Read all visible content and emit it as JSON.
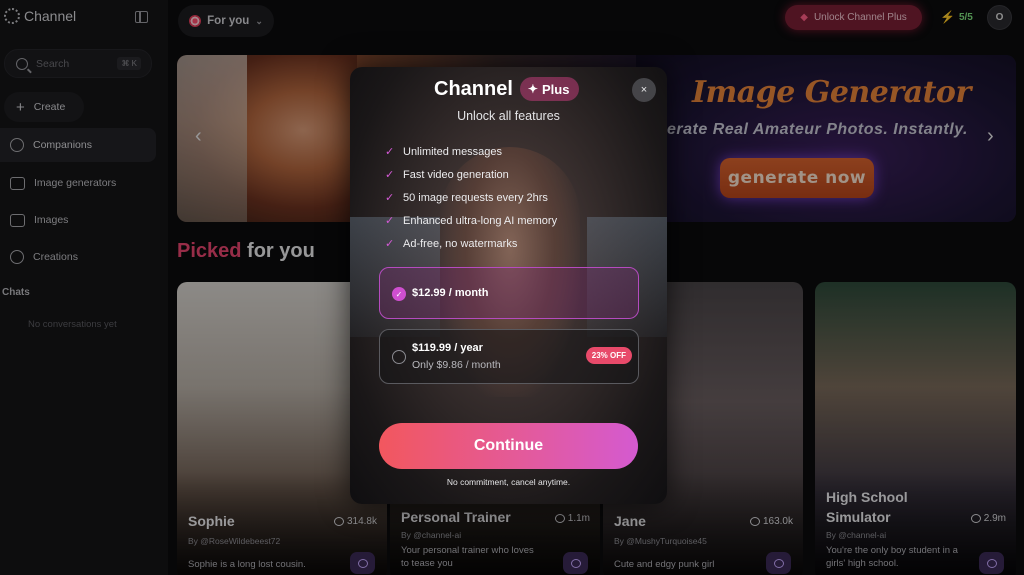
{
  "sidebar": {
    "brand": "Channel",
    "search_placeholder": "Search",
    "search_shortcut": "⌘ K",
    "create_label": "Create",
    "items": [
      {
        "label": "Companions"
      },
      {
        "label": "Image generators"
      },
      {
        "label": "Images"
      },
      {
        "label": "Creations"
      }
    ],
    "chats_heading": "Chats",
    "empty_chats": "No conversations yet"
  },
  "topbar": {
    "feed_selector": "For you",
    "unlock_label": "Unlock Channel Plus",
    "energy": "5/5",
    "avatar_initial": "O"
  },
  "banner": {
    "title": "Image Generator",
    "subtitle": "erate Real Amateur Photos. Instantly.",
    "cta": "generate now",
    "prev_arrow": "‹",
    "next_arrow": "›"
  },
  "picked": {
    "highlight": "Picked",
    "rest": "for you"
  },
  "cards": [
    {
      "name": "Sophie",
      "count": "314.8k",
      "by": "By @RoseWildebeest72",
      "desc": "Sophie is a long lost cousin."
    },
    {
      "name": "Personal Trainer",
      "count": "1.1m",
      "by": "By @channel-ai",
      "desc": "Your personal trainer who loves to tease you"
    },
    {
      "name": "Jane",
      "count": "163.0k",
      "by": "By @MushyTurquoise45",
      "desc": "Cute and edgy punk girl"
    },
    {
      "name": "High School Simulator",
      "count": "2.9m",
      "by": "By @channel-ai",
      "desc": "You're the only boy student in a girls' high school."
    }
  ],
  "modal": {
    "title": "Channel",
    "badge": "Plus",
    "subtitle": "Unlock all features",
    "close": "×",
    "features": [
      "Unlimited messages",
      "Fast video generation",
      "50 image requests every 2hrs",
      "Enhanced ultra-long AI memory",
      "Ad-free, no watermarks"
    ],
    "plans": {
      "monthly": {
        "price": "$12.99 / month",
        "selected": true
      },
      "yearly": {
        "price": "$119.99 / year",
        "note": "Only $9.86 / month",
        "discount": "23% OFF",
        "selected": false
      }
    },
    "continue_label": "Continue",
    "footnote": "No commitment, cancel anytime."
  },
  "colors": {
    "accent_pink": "#e8456f",
    "plan_border": "#b54bbf",
    "energy_green": "#45d14b"
  }
}
